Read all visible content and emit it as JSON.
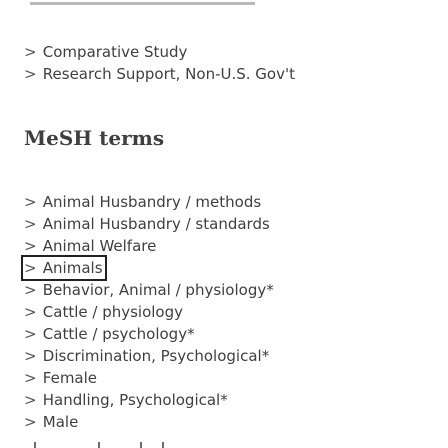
{
  "publication_types": {
    "items": [
      {
        "label": "Comparative Study"
      },
      {
        "label": "Research Support, Non-U.S. Gov't"
      }
    ]
  },
  "mesh": {
    "heading": "MeSH terms",
    "items": [
      {
        "label": "Animal Husbandry / methods"
      },
      {
        "label": "Animal Husbandry / standards"
      },
      {
        "label": "Animal Welfare"
      },
      {
        "label": "Animals",
        "focused": true
      },
      {
        "label": "Behavior, Animal / physiology*"
      },
      {
        "label": "Cattle / physiology"
      },
      {
        "label": "Cattle / psychology*"
      },
      {
        "label": "Discrimination, Psychological*"
      },
      {
        "label": "Female"
      },
      {
        "label": "Handling, Psychological*"
      },
      {
        "label": "Male"
      }
    ]
  },
  "icons": {
    "expand": "chevron-right-icon"
  },
  "colors": {
    "text": "#3f3f3f",
    "focus_outline": "#222222",
    "background": "#ffffff"
  }
}
